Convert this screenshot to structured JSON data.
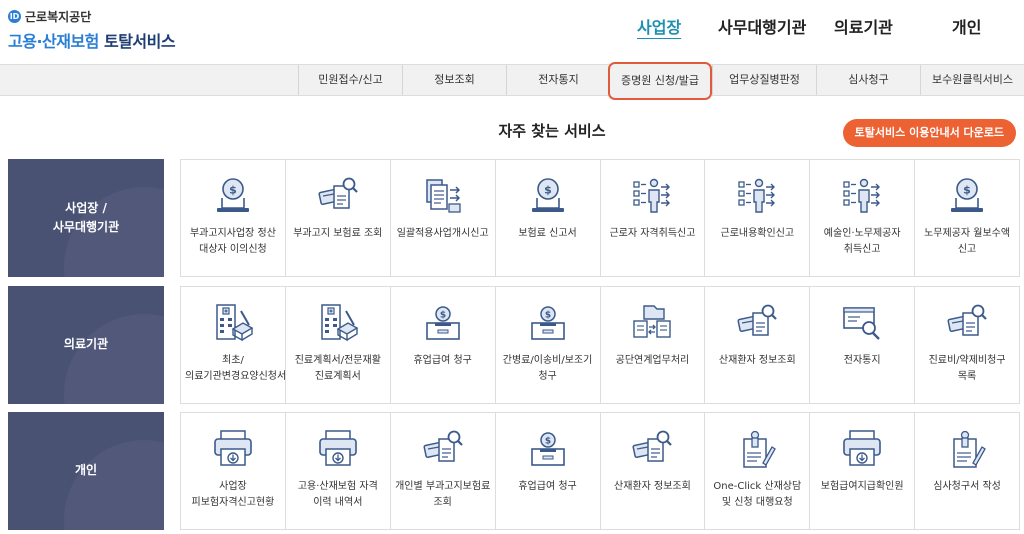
{
  "logo": {
    "mark": "ID",
    "org": "근로복지공단",
    "title_accent": "고용·산재보험",
    "title_rest": "토탈서비스"
  },
  "topnav": [
    {
      "label": "사업장",
      "active": true
    },
    {
      "label": "사무대행기관",
      "active": false
    },
    {
      "label": "의료기관",
      "active": false
    },
    {
      "label": "개인",
      "active": false
    }
  ],
  "subnav": [
    {
      "label": "민원접수/신고"
    },
    {
      "label": "정보조회"
    },
    {
      "label": "전자통지"
    },
    {
      "label": "증명원 신청/발급",
      "highlight": true
    },
    {
      "label": "업무상질병판정"
    },
    {
      "label": "심사청구"
    },
    {
      "label": "보수원클릭서비스"
    }
  ],
  "section_title": "자주 찾는 서비스",
  "download_label": "토탈서비스 이용안내서 다운로드",
  "rows": [
    {
      "label": "사업장 /\n사무대행기관",
      "cards": [
        {
          "icon": "coin-laptop-icon",
          "label": "부과고지사업장 정산 대상자 이의신청"
        },
        {
          "icon": "card-search-icon",
          "label": "부과고지 보험료 조회"
        },
        {
          "icon": "document-transfer-icon",
          "label": "일괄적용사업개시신고"
        },
        {
          "icon": "coin-laptop-icon",
          "label": "보험료 신고서"
        },
        {
          "icon": "worker-checklist-icon",
          "label": "근로자 자격취득신고"
        },
        {
          "icon": "worker-checklist-icon",
          "label": "근로내용확인신고"
        },
        {
          "icon": "worker-checklist-icon",
          "label": "예술인·노무제공자 취득신고"
        },
        {
          "icon": "coin-laptop-icon",
          "label": "노무제공자 월보수액 신고"
        }
      ]
    },
    {
      "label": "의료기관",
      "cards": [
        {
          "icon": "hospital-document-icon",
          "label": "최초/의료기관변경요양신청서"
        },
        {
          "icon": "hospital-document-icon",
          "label": "진료계획서/전문재활 진료계획서"
        },
        {
          "icon": "coin-box-icon",
          "label": "휴업급여 청구"
        },
        {
          "icon": "coin-box-icon",
          "label": "간병료/이송비/보조기 청구"
        },
        {
          "icon": "folder-exchange-icon",
          "label": "공단연계업무처리"
        },
        {
          "icon": "card-search-icon",
          "label": "산재환자 정보조회"
        },
        {
          "icon": "monitor-search-icon",
          "label": "전자통지"
        },
        {
          "icon": "card-search-icon",
          "label": "진료비/약제비청구 목록"
        }
      ]
    },
    {
      "label": "개인",
      "cards": [
        {
          "icon": "printer-download-icon",
          "label": "사업장 피보험자격신고현황"
        },
        {
          "icon": "printer-download-icon",
          "label": "고용·산재보험 자격 이력 내역서"
        },
        {
          "icon": "card-search-icon",
          "label": "개인별 부과고지보험료 조회"
        },
        {
          "icon": "coin-box-icon",
          "label": "휴업급여 청구"
        },
        {
          "icon": "card-search-icon",
          "label": "산재환자 정보조회"
        },
        {
          "icon": "document-pen-icon",
          "label": "One-Click 산재상담 및 신청 대행요청"
        },
        {
          "icon": "printer-download-icon",
          "label": "보험급여지급확인원"
        },
        {
          "icon": "document-pen-icon",
          "label": "심사청구서 작성"
        }
      ]
    }
  ],
  "colors": {
    "navy": "#4a5274",
    "icon_blue": "#3b5a8a",
    "orange": "#ed6233",
    "active_teal": "#1f8fb0",
    "highlight_red": "#e05b3c"
  }
}
